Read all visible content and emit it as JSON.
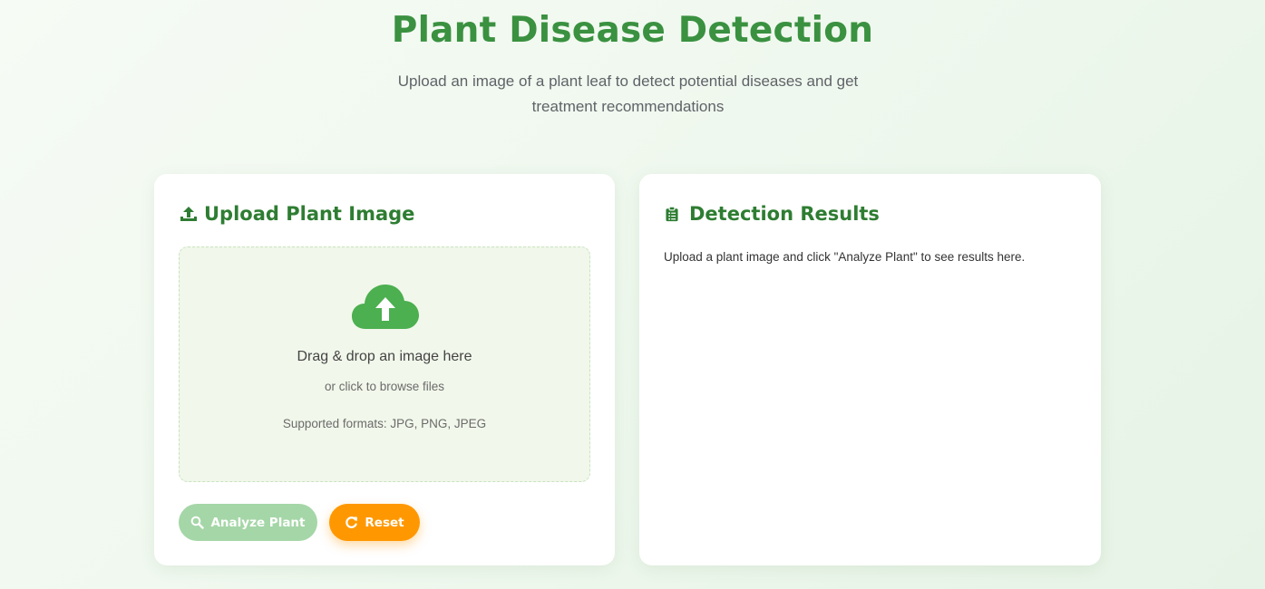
{
  "header": {
    "title": "Plant Disease Detection",
    "subtitle": "Upload an image of a plant leaf to detect potential diseases and get treatment recommendations"
  },
  "upload_card": {
    "title": "Upload Plant Image",
    "icon": "upload-icon",
    "dropzone": {
      "icon": "cloud-upload-icon",
      "main_text": "Drag & drop an image here",
      "sub_text": "or click to browse files",
      "formats_text": "Supported formats: JPG, PNG, JPEG"
    },
    "buttons": {
      "analyze_label": "Analyze Plant",
      "analyze_icon": "search-icon",
      "reset_label": "Reset",
      "reset_icon": "redo-icon"
    }
  },
  "results_card": {
    "title": "Detection Results",
    "icon": "clipboard-list-icon",
    "placeholder_text": "Upload a plant image and click \"Analyze Plant\" to see results here."
  },
  "colors": {
    "brand_green": "#3a9140",
    "heading_green": "#2e7d32",
    "cloud_green": "#4caf50",
    "analyze_disabled": "#a5d6a7",
    "reset_orange": "#ff9800",
    "dropzone_bg": "#f1f7ea"
  }
}
